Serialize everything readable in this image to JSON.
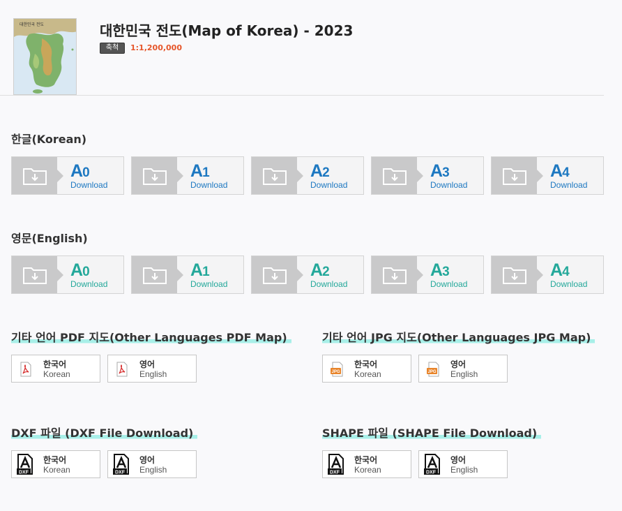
{
  "header": {
    "title": "대한민국 전도(Map of Korea) - 2023",
    "scale_label": "축척",
    "scale_value": "1:1,200,000"
  },
  "sections": {
    "korean": {
      "title": "한글(Korean)"
    },
    "english": {
      "title": "영문(English)"
    },
    "pdf": {
      "title": "기타 언어 PDF 지도(Other Languages PDF Map)"
    },
    "jpg": {
      "title": "기타 언어 JPG 지도(Other Languages JPG Map)"
    },
    "dxf": {
      "title": "DXF 파일 (DXF File Download)"
    },
    "shape": {
      "title": "SHAPE 파일 (SHAPE File Download)"
    }
  },
  "sizes": [
    {
      "letter": "A",
      "num": "0",
      "word": "Download"
    },
    {
      "letter": "A",
      "num": "1",
      "word": "Download"
    },
    {
      "letter": "A",
      "num": "2",
      "word": "Download"
    },
    {
      "letter": "A",
      "num": "3",
      "word": "Download"
    },
    {
      "letter": "A",
      "num": "4",
      "word": "Download"
    }
  ],
  "langs": {
    "korean": {
      "ko": "한국어",
      "en": "Korean"
    },
    "english": {
      "ko": "영어",
      "en": "English"
    }
  },
  "thumbnail": {
    "caption": "대한민국 전도"
  },
  "icons": {
    "download": "folder-download-icon",
    "pdf": "pdf-file-icon",
    "jpg": "jpg-file-icon",
    "dxf": "dxf-file-icon"
  },
  "colors": {
    "korean_accent": "#1d78c1",
    "english_accent": "#23a89a",
    "scale_value": "#e6562a",
    "title_highlight": "#a8efe8"
  }
}
